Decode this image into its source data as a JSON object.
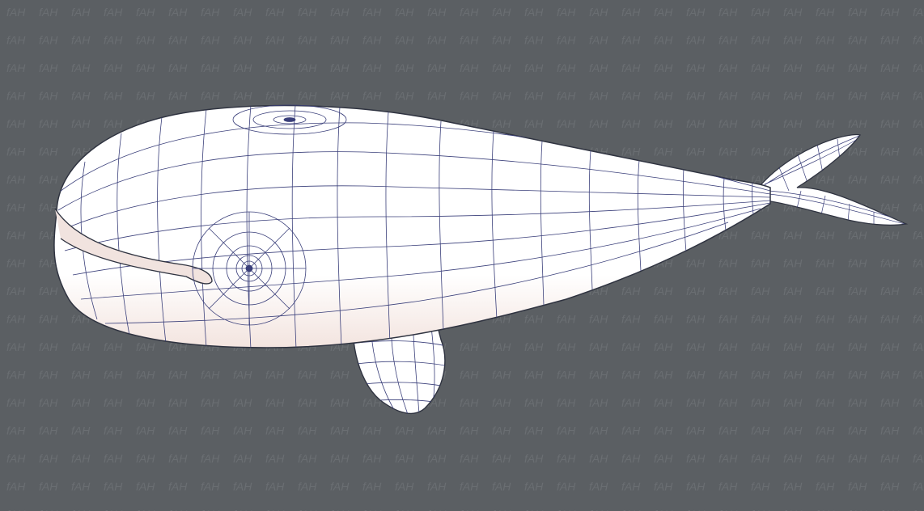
{
  "scene": {
    "subject": "whale-wireframe-model",
    "colors": {
      "background": "#5b5f63",
      "watermark": "#6a6e72",
      "body_fill": "#ffffff",
      "body_underside": "#f3e6e2",
      "wire": "#3a3f7a",
      "outline": "#2f3340"
    },
    "watermark_text": "fAH"
  }
}
